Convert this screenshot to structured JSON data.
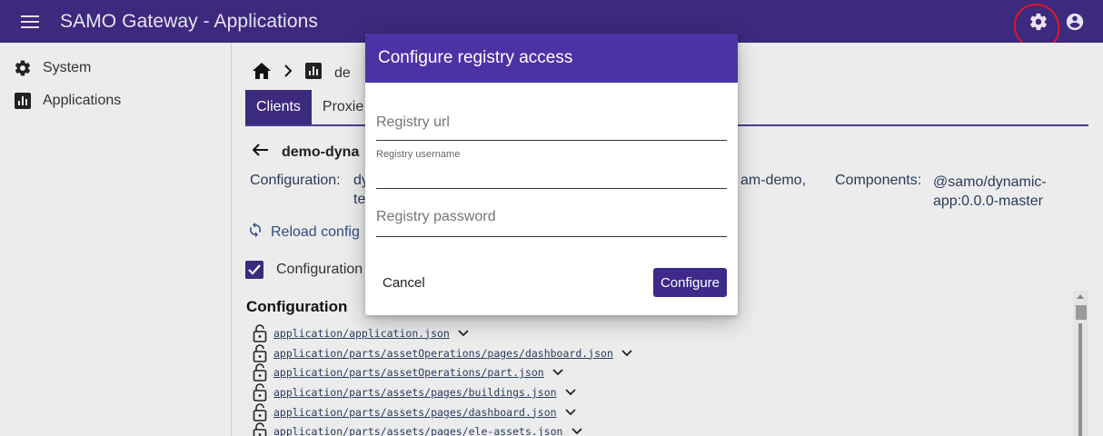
{
  "appbar": {
    "title": "SAMO Gateway - Applications",
    "menu_icon": "hamburger-menu-icon",
    "settings_icon": "gear-icon",
    "account_icon": "account-circle-icon",
    "color": "#3b2a7d",
    "annotation_color": "#e0162b"
  },
  "sidebar": {
    "items": [
      {
        "label": "System",
        "icon": "gear-icon"
      },
      {
        "label": "Applications",
        "icon": "bar-chart-icon"
      }
    ]
  },
  "main": {
    "breadcrumb": {
      "home_icon": "home-icon",
      "separator_icon": "chevron-right-icon",
      "app_icon": "bar-chart-icon",
      "text": "de"
    },
    "tabs": [
      {
        "label": "Clients",
        "active": true
      },
      {
        "label": "Proxie",
        "active": false
      }
    ],
    "app_name": "demo-dyna",
    "configuration_label": "Configuration:",
    "configuration_value_1": "dy",
    "configuration_value_2": "te",
    "configuration_value_3": "am-demo,",
    "components_label": "Components:",
    "components_value": "@samo/dynamic-app:0.0.0-master",
    "reload_label": "Reload config",
    "checkbox_label": "Configuration",
    "config_heading": "Configuration",
    "files": [
      "application/application.json",
      "application/parts/assetOperations/pages/dashboard.json",
      "application/parts/assetOperations/part.json",
      "application/parts/assets/pages/buildings.json",
      "application/parts/assets/pages/dashboard.json",
      "application/parts/assets/pages/ele-assets.json"
    ]
  },
  "dialog": {
    "title": "Configure registry access",
    "header_color": "#4a33a5",
    "url_placeholder": "Registry url",
    "username_label": "Registry username",
    "password_placeholder": "Registry password",
    "cancel_label": "Cancel",
    "configure_label": "Configure"
  }
}
